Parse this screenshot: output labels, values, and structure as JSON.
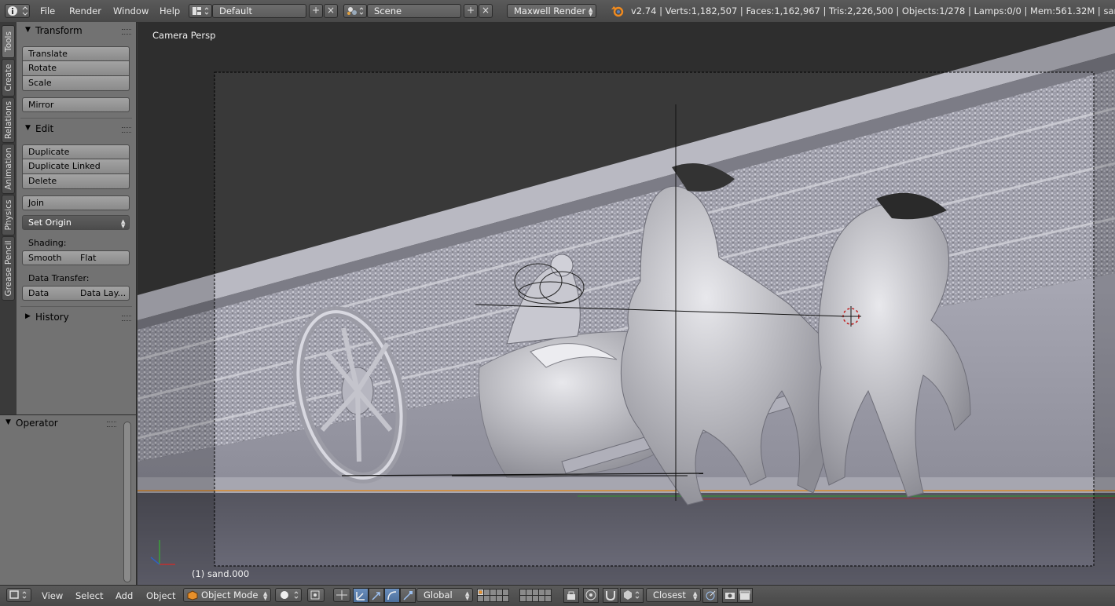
{
  "top_header": {
    "editor_icon": "info-icon",
    "menus": [
      "File",
      "Render",
      "Window",
      "Help"
    ],
    "layout_name": "Default",
    "scene_name": "Scene",
    "render_engine": "Maxwell Render",
    "stats": "v2.74 | Verts:1,182,507 | Faces:1,162,967 | Tris:2,226,500 | Objects:1/278 | Lamps:0/0 | Mem:561.32M | sand.000"
  },
  "tabs": [
    "Tools",
    "Create",
    "Relations",
    "Animation",
    "Physics",
    "Grease Pencil"
  ],
  "tool_shelf": {
    "transform": {
      "title": "Transform",
      "buttons": [
        "Translate",
        "Rotate",
        "Scale"
      ],
      "mirror": "Mirror"
    },
    "edit": {
      "title": "Edit",
      "buttons": [
        "Duplicate",
        "Duplicate Linked",
        "Delete"
      ],
      "join": "Join",
      "set_origin": "Set Origin",
      "shading_label": "Shading:",
      "shading_buttons": [
        "Smooth",
        "Flat"
      ],
      "data_transfer_label": "Data Transfer:",
      "data_transfer_buttons": [
        "Data",
        "Data Lay..."
      ]
    },
    "history": {
      "title": "History"
    }
  },
  "operator_panel": {
    "title": "Operator"
  },
  "viewport": {
    "label": "Camera Persp",
    "status": "(1) sand.000"
  },
  "bottom_header": {
    "menus": [
      "View",
      "Select",
      "Add",
      "Object"
    ],
    "mode": "Object Mode",
    "orientation": "Global",
    "snap_target": "Closest"
  },
  "colors": {
    "header_bg": "#4f4f4f",
    "panel_bg": "#727272",
    "viewport_bg": "#393939",
    "active_toggle": "#5680c2"
  }
}
